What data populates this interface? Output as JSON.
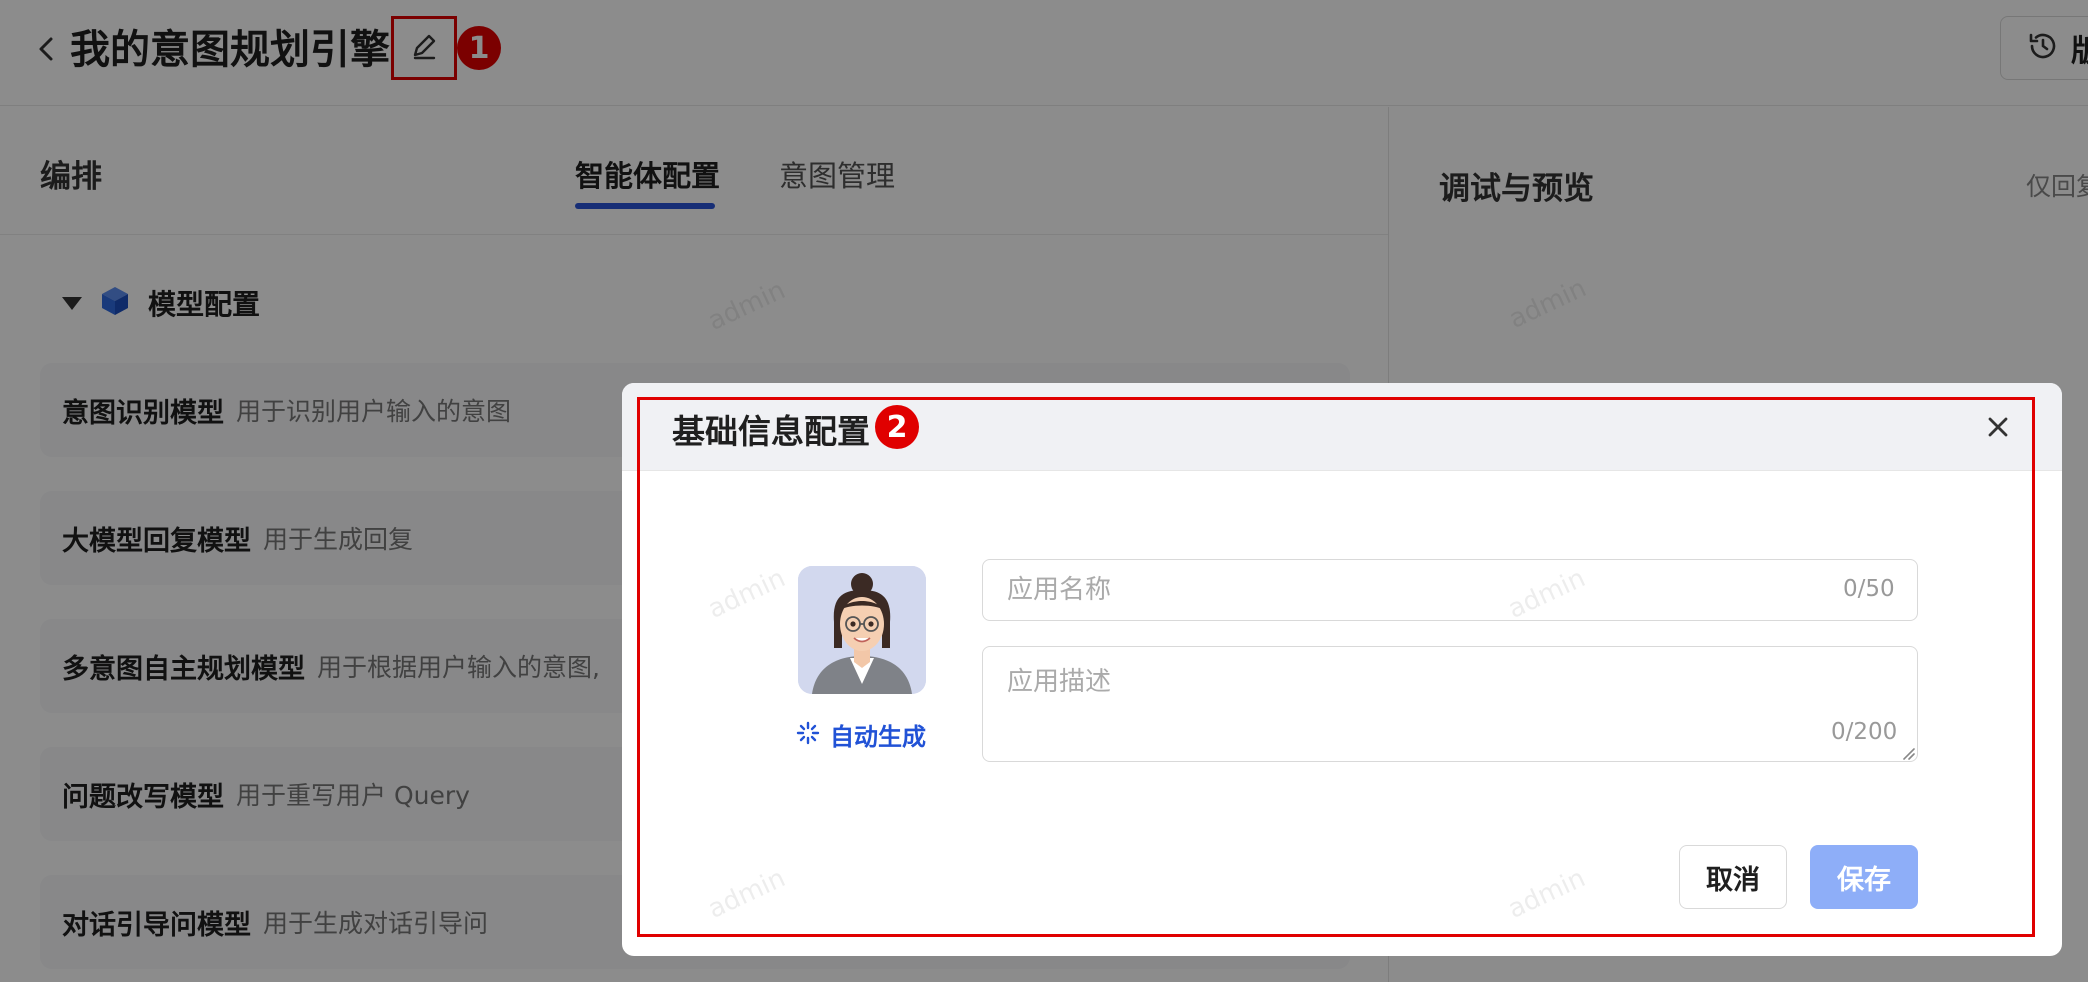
{
  "header": {
    "title": "我的意图规划引擎",
    "marker_1": "1",
    "history_label": "版"
  },
  "left_panel": {
    "title": "编排",
    "tabs": [
      {
        "label": "智能体配置",
        "active": true
      },
      {
        "label": "意图管理",
        "active": false
      }
    ],
    "section_title": "模型配置",
    "models": [
      {
        "name": "意图识别模型",
        "desc": "用于识别用户输入的意图"
      },
      {
        "name": "大模型回复模型",
        "desc": "用于生成回复"
      },
      {
        "name": "多意图自主规划模型",
        "desc": "用于根据用户输入的意图,"
      },
      {
        "name": "问题改写模型",
        "desc": "用于重写用户 Query"
      },
      {
        "name": "对话引导问模型",
        "desc": "用于生成对话引导问"
      }
    ]
  },
  "right_panel": {
    "title": "调试与预览",
    "note": "仅回复"
  },
  "watermark_text": "admin",
  "modal": {
    "title": "基础信息配置",
    "marker_2": "2",
    "auto_generate_label": "自动生成",
    "name_field": {
      "placeholder": "应用名称",
      "value": "",
      "counter": "0/50"
    },
    "desc_field": {
      "placeholder": "应用描述",
      "value": "",
      "counter": "0/200"
    },
    "cancel_label": "取消",
    "save_label": "保存"
  },
  "colors": {
    "accent": "#2b55d8",
    "marker_red": "#e00000",
    "save_disabled": "#8eaef8",
    "link_blue": "#2152d6"
  },
  "icons": [
    "back-arrow-icon",
    "edit-pencil-icon",
    "history-icon",
    "cube-icon",
    "close-icon",
    "sparkle-icon"
  ]
}
